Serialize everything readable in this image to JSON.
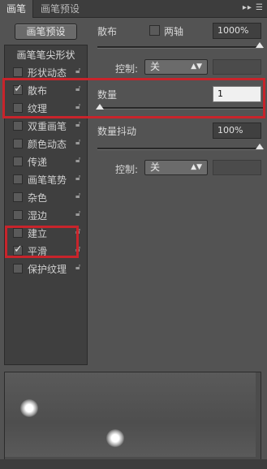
{
  "tabs": [
    {
      "label": "画笔"
    },
    {
      "label": "画笔预设"
    }
  ],
  "tab_menu_icon": "panel-menu-icon",
  "preset_button": "画笔预设",
  "left_items": [
    {
      "label": "画笔笔尖形状",
      "header": true
    },
    {
      "label": "形状动态",
      "checked": false,
      "locked": true
    },
    {
      "label": "散布",
      "checked": true,
      "locked": true
    },
    {
      "label": "纹理",
      "checked": false,
      "locked": true
    },
    {
      "label": "双重画笔",
      "checked": false,
      "locked": true
    },
    {
      "label": "颜色动态",
      "checked": false,
      "locked": true
    },
    {
      "label": "传递",
      "checked": false,
      "locked": true
    },
    {
      "label": "画笔笔势",
      "checked": false,
      "locked": true
    },
    {
      "label": "杂色",
      "checked": false,
      "locked": true
    },
    {
      "label": "湿边",
      "checked": false,
      "locked": true
    },
    {
      "label": "建立",
      "checked": false,
      "locked": true
    },
    {
      "label": "平滑",
      "checked": true,
      "locked": true
    },
    {
      "label": "保护纹理",
      "checked": false,
      "locked": true
    }
  ],
  "scatter": {
    "label": "散布",
    "both_axes_label": "两轴",
    "both_axes_checked": false,
    "value": "1000%",
    "slider_level": 1.0
  },
  "control1": {
    "label": "控制:",
    "value": "关"
  },
  "count": {
    "label": "数量",
    "value": "1",
    "slider_level": 0.0
  },
  "count_jitter": {
    "label": "数量抖动",
    "value": "100%",
    "slider_level": 1.0
  },
  "control2": {
    "label": "控制:",
    "value": "关"
  },
  "colors": {
    "highlight": "#c8242b",
    "panel": "#535353",
    "list_bg": "#3f3f3f"
  }
}
